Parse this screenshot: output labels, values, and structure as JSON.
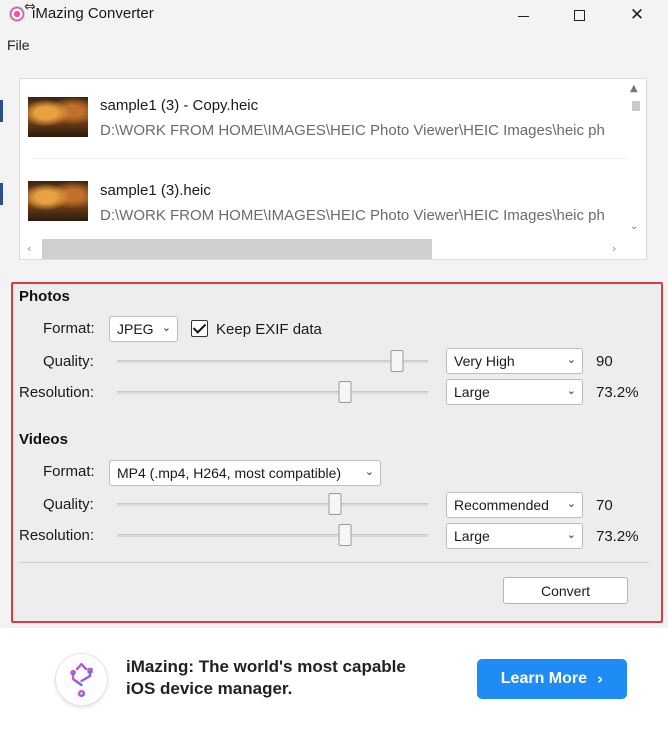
{
  "window": {
    "title": "iMazing Converter",
    "close_glyph": "✕"
  },
  "menu": {
    "file": "File"
  },
  "files": [
    {
      "name": "sample1 (3) - Copy.heic",
      "path": "D:\\WORK FROM HOME\\IMAGES\\HEIC Photo Viewer\\HEIC Images\\heic ph"
    },
    {
      "name": "sample1 (3).heic",
      "path": "D:\\WORK FROM HOME\\IMAGES\\HEIC Photo Viewer\\HEIC Images\\heic ph"
    }
  ],
  "photos": {
    "section_title": "Photos",
    "format_label": "Format:",
    "format_value": "JPEG",
    "keep_exif_label": "Keep EXIF data",
    "keep_exif_checked": true,
    "quality_label": "Quality:",
    "quality_preset": "Very High",
    "quality_value": "90",
    "quality_level": 0.9,
    "resolution_label": "Resolution:",
    "resolution_preset": "Large",
    "resolution_value": "73.2%",
    "resolution_level": 0.732
  },
  "videos": {
    "section_title": "Videos",
    "format_label": "Format:",
    "format_value": "MP4 (.mp4, H264, most compatible)",
    "quality_label": "Quality:",
    "quality_preset": "Recommended",
    "quality_value": "70",
    "quality_level": 0.7,
    "resolution_label": "Resolution:",
    "resolution_preset": "Large",
    "resolution_value": "73.2%",
    "resolution_level": 0.732
  },
  "actions": {
    "convert": "Convert"
  },
  "ad": {
    "headline": "iMazing: The world's most capable iOS device manager.",
    "button": "Learn More",
    "button_color": "#1f8cf5"
  },
  "colors": {
    "highlight_border": "#d83b41",
    "window_bg": "#f3f3f3"
  },
  "icons": {
    "app": "imazing-app-icon",
    "ad_logo": "imazing-usb-logo-icon",
    "dropdown": "chevron-down-icon"
  }
}
